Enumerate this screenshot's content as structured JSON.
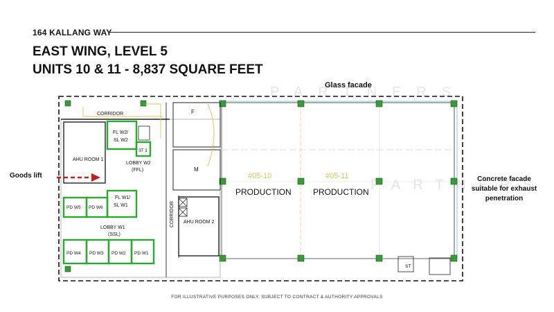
{
  "header": {
    "address": "164 KALLANG WAY",
    "title_line1": "EAST WING, LEVEL 5",
    "title_line2": "UNITS 10 & 11 - 8,837 SQUARE FEET"
  },
  "annotations": {
    "glass_facade": "Glass facade",
    "goods_lift": "Goods lift",
    "concrete_facade": "Concrete facade suitable for exhaust penetration"
  },
  "watermark": "PARTNERS",
  "plan_labels": {
    "corridor_top": "CORRIDOR",
    "corridor_side": "CORRIDOR",
    "ahu_room_1": "AHU ROOM 1",
    "ahu_room_2": "AHU ROOM 2",
    "fl_w2": "FL W2/",
    "sl_w2": "SL W2",
    "st3": "ST 3",
    "lobby_w2": "LOBBY W2",
    "ffl": "(FFL)",
    "fl_w1": "FL W1/",
    "sl_w1": "SL W1",
    "pd_w5": "PD W5",
    "pd_w6": "PD W6",
    "lobby_w1": "LOBBY W1",
    "ssl": "(SSL)",
    "pd_w4": "PD W4",
    "pd_w3": "PD W3",
    "pd_w2": "PD W2",
    "pd_w1": "PD W1",
    "f_room": "F",
    "m_room": "M",
    "unit_10": "#05-10",
    "unit_11": "#05-11",
    "production_1": "PRODUCTION",
    "production_2": "PRODUCTION",
    "st_bottom": "ST"
  },
  "colors": {
    "green_outline": "#2aa832",
    "red_arrow": "#c0201c",
    "unit_number": "#d9c25a",
    "column": "#3a9a3a",
    "facade_glass": "#7ccfe0"
  },
  "footer": "FOR ILLUSTRATIVE PURPOSES ONLY, SUBJECT TO CONTRACT & AUTHORITY APPROVALS"
}
